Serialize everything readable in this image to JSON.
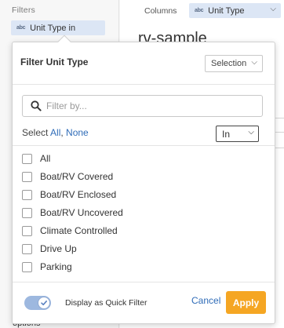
{
  "sidebar": {
    "filters_label": "Filters",
    "active_filter": "Unit Type in",
    "field_type_badge": "abc",
    "bottom_label": "options"
  },
  "toolbar": {
    "columns_label": "Columns",
    "column_field": "Unit Type",
    "column_type_badge": "abc"
  },
  "report": {
    "title_fragment": "rv-sample"
  },
  "filter_panel": {
    "title": "Filter Unit Type",
    "mode_select": "Selection",
    "search_placeholder": "Filter by...",
    "select_label": "Select",
    "select_all": "All",
    "select_none": "None",
    "operator": "In",
    "options": [
      {
        "label": "All",
        "checked": false
      },
      {
        "label": "Boat/RV Covered",
        "checked": false
      },
      {
        "label": "Boat/RV Enclosed",
        "checked": false
      },
      {
        "label": "Boat/RV Uncovered",
        "checked": false
      },
      {
        "label": "Climate Controlled",
        "checked": false
      },
      {
        "label": "Drive Up",
        "checked": false
      },
      {
        "label": "Parking",
        "checked": false
      }
    ],
    "quick_filter_label": "Display as Quick Filter",
    "quick_filter_enabled": true,
    "cancel_label": "Cancel",
    "apply_label": "Apply"
  },
  "colors": {
    "accent": "#f5a623",
    "link": "#2f6cb8",
    "chip": "#dce6f5",
    "toggle": "#9db8df"
  }
}
